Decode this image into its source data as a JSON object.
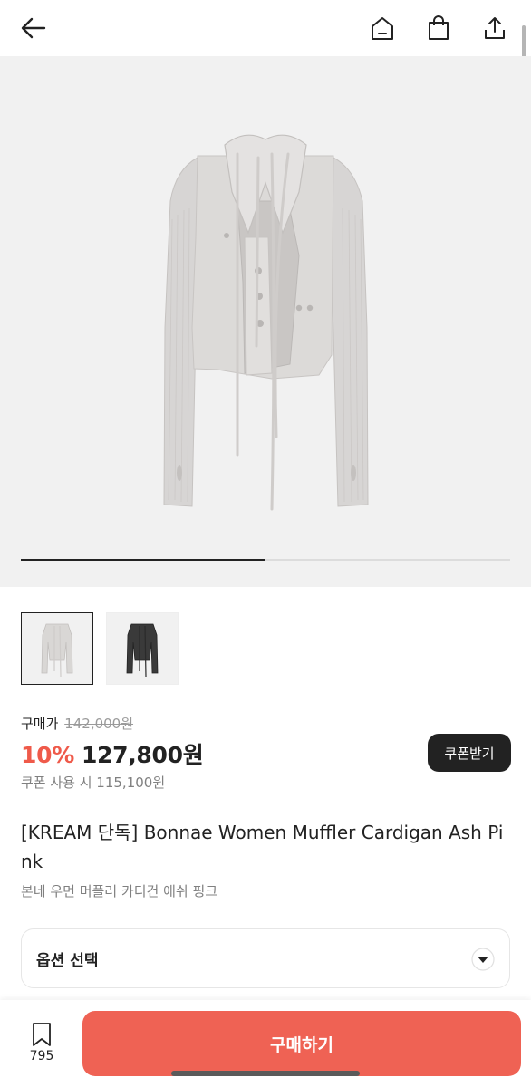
{
  "header": {
    "back_icon": "arrow-left-icon",
    "home_icon": "home-icon",
    "bag_icon": "shopping-bag-icon",
    "share_icon": "share-icon"
  },
  "gallery": {
    "progress": 0.5,
    "thumbnails": [
      {
        "name": "ash-pink",
        "selected": true
      },
      {
        "name": "black",
        "selected": false
      }
    ]
  },
  "price": {
    "label": "구매가",
    "original": "142,000원",
    "discount": "10%",
    "current": "127,800원",
    "coupon_text": "쿠폰 사용 시 115,100원",
    "coupon_button": "쿠폰받기",
    "discount_color": "#ef5a4a"
  },
  "product": {
    "title": "[KREAM 단독] Bonnae Women Muffler Cardigan Ash Pink",
    "subtitle": "본네 우먼 머플러 카디건 애쉬 핑크"
  },
  "option": {
    "label": "옵션 선택",
    "icon": "chevron-down-icon"
  },
  "bottom": {
    "wish_icon": "bookmark-icon",
    "wish_count": "795",
    "buy_label": "구매하기",
    "buy_color": "#ef6254"
  }
}
